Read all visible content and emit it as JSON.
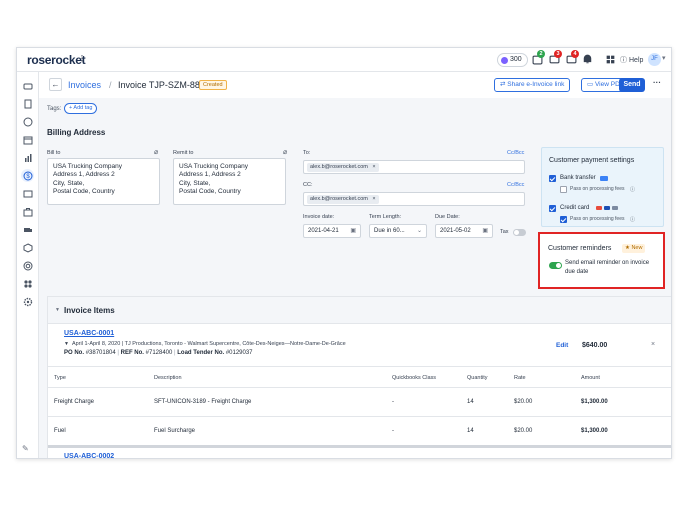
{
  "topbar": {
    "logo": "roserocket",
    "logo_menu": "⠇",
    "points": "300",
    "badges": [
      "2",
      "3",
      "4"
    ],
    "help": "Help",
    "avatar_initial": "JF"
  },
  "header": {
    "back": "←",
    "breadcrumb_link": "Invoices",
    "separator": "/",
    "title": "Invoice TJP-SZM-88",
    "status": "Created",
    "share_label": "Share e-Invoice link",
    "view_pdf_label": "View PDF",
    "send_label": "Send",
    "more": "···"
  },
  "tags": {
    "label": "Tags:",
    "add_label": "+ Add tag"
  },
  "billing": {
    "title": "Billing Address",
    "bill_to_label": "Bill to",
    "remit_to_label": "Remit to",
    "bill_to_lines": [
      "USA Trucking Company",
      "Address 1, Address 2",
      "City, State,",
      "Postal Code, Country"
    ],
    "remit_to_lines": [
      "USA Trucking Company",
      "Address 1, Address 2",
      "City, State,",
      "Postal Code, Country"
    ]
  },
  "email": {
    "to_label": "To:",
    "cc_label": "CC:",
    "ccbcc": "Cc/Bcc",
    "to_chip": "alex.b@roserocket.com",
    "cc_chip": "alex.b@roserocket.com",
    "chip_close": "×"
  },
  "dates": {
    "invoice_date_label": "Invoice date:",
    "invoice_date": "2021-04-21",
    "term_label": "Term Length:",
    "term_value": "Due in 60...",
    "due_label": "Due Date:",
    "due_date": "2021-05-02",
    "tax_label": "Tax"
  },
  "payment": {
    "title": "Customer payment settings",
    "bank_transfer": "Bank transfer",
    "bank_pass": "Pass on processing fees",
    "credit_card": "Credit card",
    "card_pass": "Pass on processing fees",
    "info": "ⓘ"
  },
  "reminders": {
    "title": "Customer reminders",
    "new_badge": "★ New",
    "text": "Send email reminder on invoice due date"
  },
  "items": {
    "title": "Invoice Items",
    "load_id": "USA-ABC-0001",
    "route": "April 1-April 8, 2020 | TJ Productions, Toronto - Walmart Supercentre, Côte-Des-Neiges—Notre-Dame-De-Grâce",
    "po_label": "PO No.",
    "po_value": "#38701804",
    "ref_label": "REF No.",
    "ref_value": "#7128400",
    "tender_label": "Load Tender No.",
    "tender_value": "#0129037",
    "edit": "Edit",
    "total": "$640.00",
    "close": "×",
    "columns": [
      "Type",
      "Description",
      "Quickbooks Class",
      "Quantity",
      "Rate",
      "Amount"
    ],
    "rows": [
      {
        "type": "Freight Charge",
        "description": "SFT-UNICON-3189 - Freight Charge",
        "class": "-",
        "quantity": "14",
        "rate": "$20.00",
        "amount": "$1,300.00"
      },
      {
        "type": "Fuel",
        "description": "Fuel Surcharge",
        "class": "-",
        "quantity": "14",
        "rate": "$20.00",
        "amount": "$1,300.00"
      }
    ],
    "next_load_id": "USA-ABC-0002"
  },
  "colors": {
    "brand": "#1f5fd6",
    "highlight_border": "#e02424",
    "toggle_on": "#2da44e"
  }
}
